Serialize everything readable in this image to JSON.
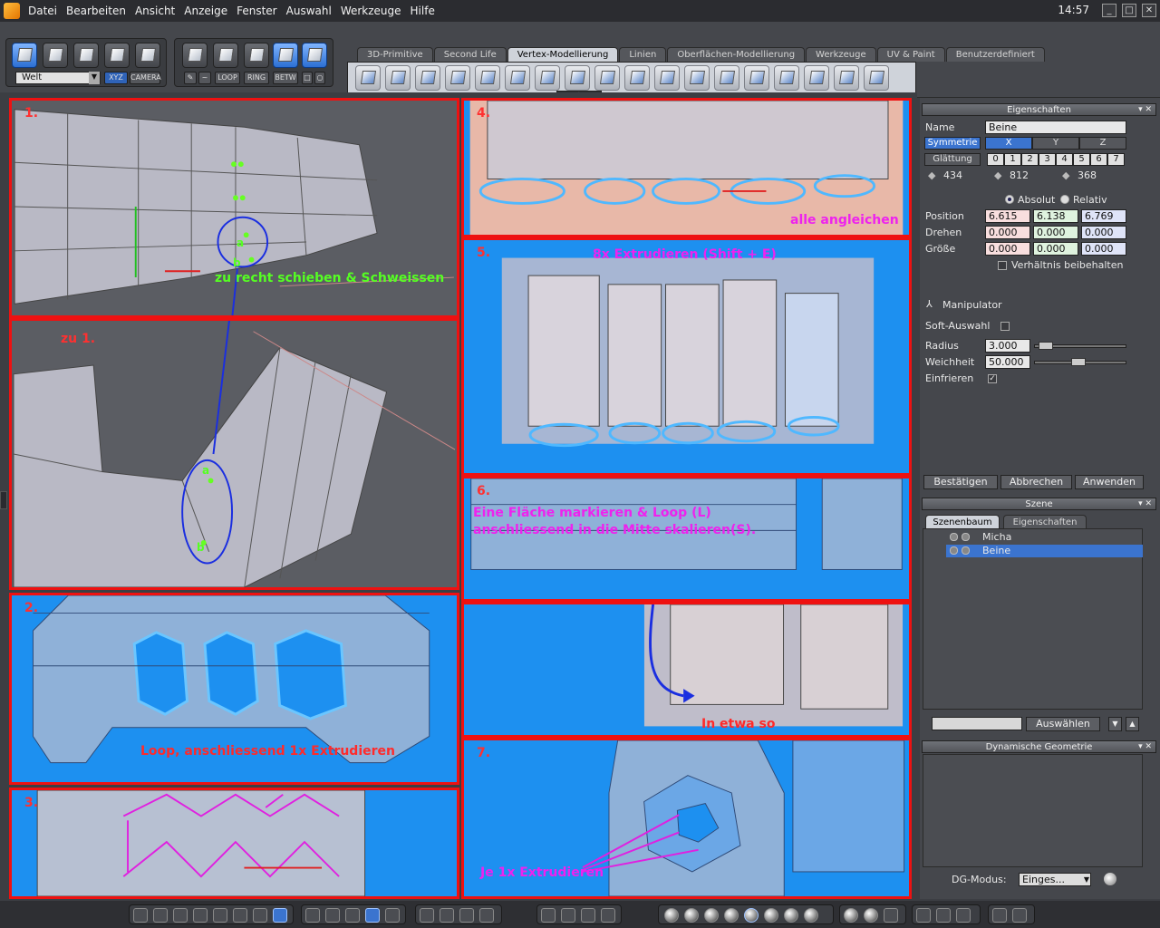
{
  "menubar": {
    "items": [
      "Datei",
      "Bearbeiten",
      "Ansicht",
      "Anzeige",
      "Fenster",
      "Auswahl",
      "Werkzeuge",
      "Hilfe"
    ],
    "clock": "14:57"
  },
  "toolbar": {
    "coord_space": "Welt",
    "xyz": "XYZ",
    "camera": "CAMERA",
    "loop": "LOOP",
    "ring": "RING",
    "betw": "BETW",
    "tabs": [
      "3D-Primitive",
      "Second Life",
      "Vertex-Modellierung",
      "Linien",
      "Oberflächen-Modellierung",
      "Werkzeuge",
      "UV & Paint",
      "Benutzerdefiniert"
    ],
    "active_tab": "Vertex-Modellierung"
  },
  "viewport": {
    "steps": {
      "s1": "1.",
      "s1b": "zu 1.",
      "s2": "2.",
      "s3": "3.",
      "s4": "4.",
      "s5": "5.",
      "s6": "6.",
      "s7": "7."
    },
    "notes": {
      "schieben": "zu recht schieben & Schweissen",
      "loop_extrude": "Loop, anschliessend 1x Extrudieren",
      "angleichen": "alle angleichen",
      "extrude8": "8x Extrudieren (Shift + E)",
      "flaeche_1": "Eine Fläche markieren & Loop (L)",
      "flaeche_2": "anschliessend in die Mitte skalieren(S).",
      "etwa": "In etwa so",
      "je1": "Je 1x Extrudieren"
    },
    "point_labels": {
      "a": "a",
      "b": "b"
    }
  },
  "properties": {
    "title": "Eigenschaften",
    "name_label": "Name",
    "name_value": "Beine",
    "symmetry_label": "Symmetrie",
    "axes": [
      "X",
      "Y",
      "Z"
    ],
    "smoothing_label": "Glättung",
    "smoothing_levels": [
      "0",
      "1",
      "2",
      "3",
      "4",
      "5",
      "6",
      "7"
    ],
    "stats": [
      "434",
      "812",
      "368"
    ],
    "absolut": "Absolut",
    "relativ": "Relativ",
    "position_label": "Position",
    "position": [
      "6.615",
      "6.138",
      "6.769"
    ],
    "rotate_label": "Drehen",
    "rotate": [
      "0.000",
      "0.000",
      "0.000"
    ],
    "size_label": "Größe",
    "size": [
      "0.000",
      "0.000",
      "0.000"
    ],
    "keep_ratio": "Verhältnis beibehalten",
    "manipulator": "Manipulator",
    "soft_select": "Soft-Auswahl",
    "radius_label": "Radius",
    "radius": "3.000",
    "softness_label": "Weichheit",
    "softness": "50.000",
    "freeze": "Einfrieren",
    "confirm": "Bestätigen",
    "cancel": "Abbrechen",
    "apply": "Anwenden"
  },
  "scene": {
    "title": "Szene",
    "tabs": [
      "Szenenbaum",
      "Eigenschaften"
    ],
    "items": [
      "Micha",
      "Beine"
    ],
    "select_button": "Auswählen"
  },
  "dyngeo": {
    "title": "Dynamische Geometrie",
    "mode_label": "DG-Modus:",
    "mode_value": "Einges..."
  }
}
